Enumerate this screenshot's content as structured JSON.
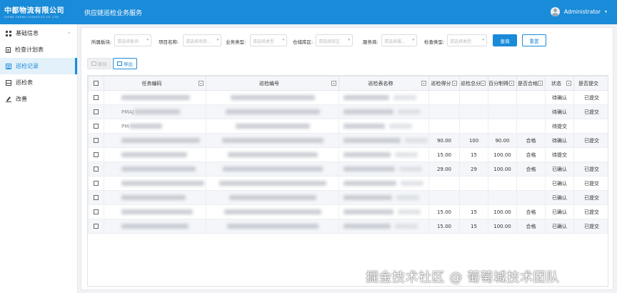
{
  "header": {
    "logo_cn": "中都物流有限公司",
    "logo_en": "CHINE CHENG LOGISTICS CO.,LTD",
    "system_title": "供应链巡检业务服务",
    "user_name": "Administrator",
    "brand_color": "#1a8bd8"
  },
  "sidebar": {
    "items": [
      {
        "label": "基础信息",
        "icon": "grid-icon",
        "has_children": true,
        "active": false
      },
      {
        "label": "检查计划表",
        "icon": "document-icon",
        "has_children": false,
        "active": false
      },
      {
        "label": "巡检记录",
        "icon": "list-icon",
        "has_children": false,
        "active": true
      },
      {
        "label": "巡检表",
        "icon": "table-icon",
        "has_children": false,
        "active": false
      },
      {
        "label": "改善",
        "icon": "edit-icon",
        "has_children": false,
        "active": false
      }
    ]
  },
  "filters": {
    "f1": {
      "label": "所属板块:",
      "placeholder": "请选择板块"
    },
    "f2": {
      "label": "项目名称:",
      "placeholder": "请选择项目..."
    },
    "f3": {
      "label": "业务类型:",
      "placeholder": "请选择类型"
    },
    "f4": {
      "label": "仓储库区:",
      "placeholder": "请选择库区"
    },
    "f5": {
      "label": "服务商:",
      "placeholder": "请选择服..."
    },
    "f6": {
      "label": "检查类型:",
      "placeholder": "请选择类型"
    },
    "search_label": "查询",
    "reset_label": "重置"
  },
  "toolbar": {
    "delete_label": "删除",
    "export_label": "导出"
  },
  "table": {
    "columns": {
      "task_no": "任务编码",
      "inspect_no": "巡检编号",
      "sheet_name": "巡检表名称",
      "score": "巡检得分",
      "total": "巡检总分",
      "pct": "百分制得分",
      "pass": "是否合格",
      "status": "状态",
      "submitted": "是否提交"
    },
    "rows": [
      {
        "score": "",
        "total": "",
        "pct": "",
        "pass": "",
        "status": "待确认",
        "submitted": "已提交",
        "prefix": ""
      },
      {
        "score": "",
        "total": "",
        "pct": "",
        "pass": "",
        "status": "待确认",
        "submitted": "已提交",
        "prefix": "PMAJ"
      },
      {
        "score": "",
        "total": "",
        "pct": "",
        "pass": "",
        "status": "待提交",
        "submitted": "",
        "prefix": "PM"
      },
      {
        "score": "90.00",
        "total": "100",
        "pct": "90.00",
        "pass": "合格",
        "status": "待确认",
        "submitted": "已提交",
        "prefix": ""
      },
      {
        "score": "15.00",
        "total": "15",
        "pct": "100.00",
        "pass": "合格",
        "status": "待提交",
        "submitted": "",
        "prefix": ""
      },
      {
        "score": "29.00",
        "total": "29",
        "pct": "100.00",
        "pass": "合格",
        "status": "已确认",
        "submitted": "已提交",
        "prefix": ""
      },
      {
        "score": "",
        "total": "",
        "pct": "",
        "pass": "",
        "status": "已确认",
        "submitted": "已提交",
        "prefix": ""
      },
      {
        "score": "",
        "total": "",
        "pct": "",
        "pass": "",
        "status": "已确认",
        "submitted": "已提交",
        "prefix": ""
      },
      {
        "score": "15.00",
        "total": "15",
        "pct": "100.00",
        "pass": "合格",
        "status": "已确认",
        "submitted": "已提交",
        "prefix": ""
      },
      {
        "score": "15.00",
        "total": "15",
        "pct": "100.00",
        "pass": "合格",
        "status": "已确认",
        "submitted": "已提交",
        "prefix": ""
      }
    ]
  },
  "watermark": "掘金技术社区 @ 葡萄城技术团队"
}
